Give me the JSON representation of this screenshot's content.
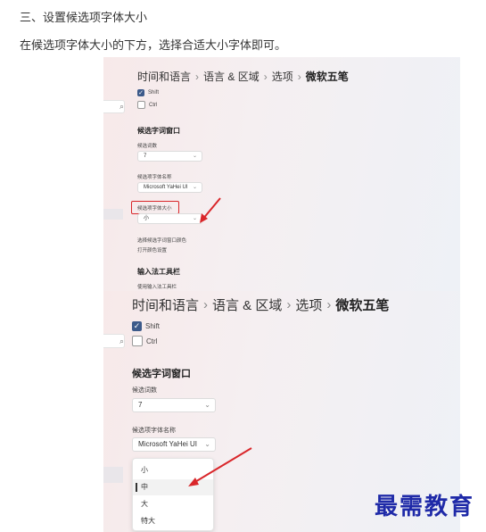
{
  "article": {
    "heading": "三、设置候选项字体大小",
    "paragraph": "在候选项字体大小的下方，选择合适大小字体即可。"
  },
  "screenshot1": {
    "breadcrumb": [
      "时间和语言",
      "语言 & 区域",
      "选项",
      "微软五笔"
    ],
    "search_icon": "⌕",
    "checkboxes": [
      {
        "label": "Shift",
        "checked": true
      },
      {
        "label": "Ctrl",
        "checked": false
      }
    ],
    "section_title": "候选字词窗口",
    "count_label": "候选词数",
    "count_value": "7",
    "font_name_label": "候选项字体名称",
    "font_name_value": "Microsoft YaHei UI",
    "font_size_label": "候选项字体大小",
    "font_size_value": "小",
    "color_label": "选择候选字词窗口颜色",
    "color_link": "打开颜色设置",
    "toolbar_title": "输入法工具栏",
    "toolbar_item": "使用输入法工具栏"
  },
  "screenshot2": {
    "breadcrumb": [
      "时间和语言",
      "语言 & 区域",
      "选项",
      "微软五笔"
    ],
    "search_icon": "⌕",
    "checkboxes": [
      {
        "label": "Shift",
        "checked": true
      },
      {
        "label": "Ctrl",
        "checked": false
      }
    ],
    "section_title": "候选字词窗口",
    "count_label": "候选词数",
    "count_value": "7",
    "font_name_label": "候选项字体名称",
    "font_name_value": "Microsoft YaHei UI",
    "size_options": [
      "小",
      "中",
      "大",
      "特大"
    ],
    "selected_option": "中"
  },
  "watermark": "最需教育",
  "colors": {
    "annotation_red": "#d9262a",
    "watermark_blue": "#1f2aa8",
    "checkbox_blue": "#3c5a8a"
  }
}
